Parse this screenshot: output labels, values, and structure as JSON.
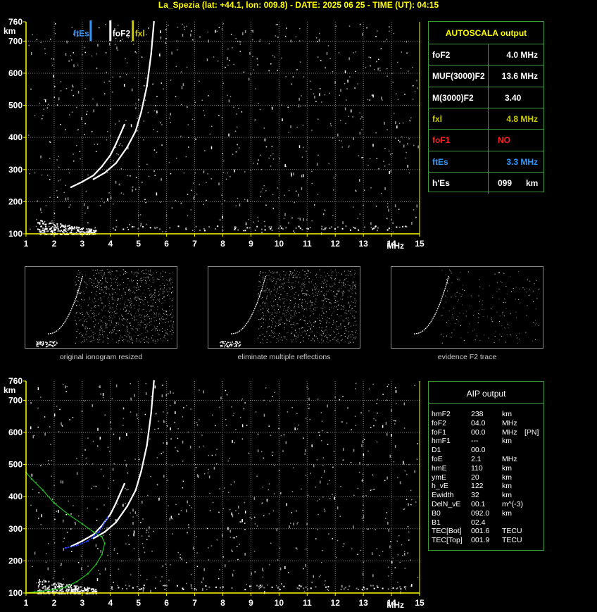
{
  "header": "La_Spezia (lat: +44.1, lon: 009.8) - DATE: 2025 06 25 - TIME (UT): 04:15",
  "colors": {
    "axis": "#ffff00",
    "grid": "#808080",
    "table_border": "#3a9a3a",
    "fxl": "#cccc00",
    "ftes": "#3399ff",
    "nofof1": "#ff2020",
    "aip_blue": "#2040ff",
    "aip_green": "#20c020"
  },
  "chart_data": [
    {
      "type": "scatter",
      "title": "",
      "xlabel": "MHz",
      "ylabel": "km",
      "xlim": [
        1,
        15
      ],
      "ylim": [
        100,
        760
      ],
      "x_ticks": [
        "1",
        "2",
        "3",
        "4",
        "5",
        "6",
        "7",
        "8",
        "9",
        "10",
        "11",
        "12",
        "13",
        "14",
        "15"
      ],
      "y_ticks": [
        "100",
        "200",
        "300",
        "400",
        "500",
        "600",
        "700",
        "760"
      ],
      "grid": true,
      "markers": [
        {
          "label": "ftEs",
          "x": 3.3,
          "color": "#3399ff"
        },
        {
          "label": "foF2",
          "x": 4.0,
          "color": "#ffffff"
        },
        {
          "label": "fxl",
          "x": 4.8,
          "color": "#cccc00"
        }
      ],
      "series": [
        {
          "x": [
            2.6,
            3.0,
            3.4,
            3.7,
            4.0,
            4.2,
            4.35,
            4.45,
            4.5
          ],
          "y": [
            245,
            262,
            282,
            310,
            345,
            380,
            410,
            430,
            440
          ]
        },
        {
          "x": [
            3.4,
            3.8,
            4.2,
            4.6,
            4.9,
            5.1,
            5.3,
            5.45,
            5.55
          ],
          "y": [
            270,
            290,
            320,
            370,
            420,
            480,
            560,
            660,
            760
          ]
        }
      ]
    },
    {
      "type": "scatter",
      "title": "",
      "xlabel": "MHz",
      "ylabel": "km",
      "xlim": [
        1,
        15
      ],
      "ylim": [
        100,
        760
      ],
      "x_ticks": [
        "1",
        "2",
        "3",
        "4",
        "5",
        "6",
        "7",
        "8",
        "9",
        "10",
        "11",
        "12",
        "13",
        "14",
        "15"
      ],
      "y_ticks": [
        "100",
        "200",
        "300",
        "400",
        "500",
        "600",
        "700",
        "760"
      ],
      "grid": true,
      "series": [
        {
          "x": [
            2.6,
            3.0,
            3.4,
            3.7,
            4.0,
            4.2,
            4.35,
            4.45,
            4.5
          ],
          "y": [
            245,
            262,
            282,
            310,
            345,
            380,
            410,
            430,
            440
          ]
        },
        {
          "x": [
            3.4,
            3.8,
            4.2,
            4.6,
            4.9,
            5.1,
            5.3,
            5.45,
            5.55
          ],
          "y": [
            270,
            290,
            320,
            370,
            420,
            480,
            560,
            660,
            760
          ]
        },
        {
          "x": [
            1.0,
            1.3,
            1.6,
            2.0,
            2.4,
            2.8,
            3.2,
            3.5,
            3.7,
            3.8,
            3.7,
            3.4,
            3.0,
            2.5,
            2.0,
            1.6,
            1.2,
            1.0
          ],
          "y": [
            100,
            103,
            106,
            110,
            118,
            135,
            160,
            190,
            220,
            255,
            275,
            290,
            315,
            345,
            380,
            420,
            455,
            475
          ]
        },
        {
          "x": [
            2.4,
            2.8,
            3.2,
            3.6,
            3.9
          ],
          "y": [
            240,
            248,
            262,
            290,
            335
          ]
        }
      ]
    }
  ],
  "autoscala": {
    "title": "AUTOSCALA output",
    "rows": [
      {
        "key": "foF2",
        "value": "4.0 MHz",
        "color": "#ffffff"
      },
      {
        "key": "MUF(3000)F2",
        "value": "13.6 MHz",
        "color": "#ffffff"
      },
      {
        "key": "M(3000)F2",
        "value": "3.40",
        "color": "#ffffff"
      },
      {
        "key": "fxl",
        "value": "4.8 MHz",
        "color": "#cccc00"
      },
      {
        "key": "foF1",
        "value": "NO",
        "color": "#ff2020"
      },
      {
        "key": "ftEs",
        "value": "3.3 MHz",
        "color": "#3399ff"
      },
      {
        "key": "h'Es",
        "value": "099",
        "unit": "km",
        "color": "#ffffff"
      }
    ]
  },
  "aip": {
    "title": "AIP output",
    "rows": [
      {
        "k": "hmF2",
        "v": "238",
        "u": "km"
      },
      {
        "k": "foF2",
        "v": "04.0",
        "u": "MHz"
      },
      {
        "k": "foF1",
        "v": "00.0",
        "u": "MHz",
        "x": "[PN]"
      },
      {
        "k": "hmF1",
        "v": "---",
        "u": "km"
      },
      {
        "k": "D1",
        "v": "00.0",
        "u": ""
      },
      {
        "k": "foE",
        "v": "2.1",
        "u": "MHz"
      },
      {
        "k": "hmE",
        "v": "110",
        "u": "km"
      },
      {
        "k": "ymE",
        "v": "20",
        "u": "km"
      },
      {
        "k": "h_vE",
        "v": "122",
        "u": "km"
      },
      {
        "k": "Ewidth",
        "v": "32",
        "u": "km"
      },
      {
        "k": "DelN_vE",
        "v": "00.1",
        "u": "m^(-3)"
      },
      {
        "k": "B0",
        "v": "092.0",
        "u": "km"
      },
      {
        "k": "B1",
        "v": "02.4",
        "u": ""
      },
      {
        "k": "TEC[Bot]",
        "v": "001.6",
        "u": "TECU"
      },
      {
        "k": "TEC[Top]",
        "v": "001.9",
        "u": "TECU"
      }
    ]
  },
  "thumbnails": [
    {
      "caption": "original ionogram resized"
    },
    {
      "caption": "eliminate multiple reflections"
    },
    {
      "caption": "evidence F2 trace"
    }
  ]
}
